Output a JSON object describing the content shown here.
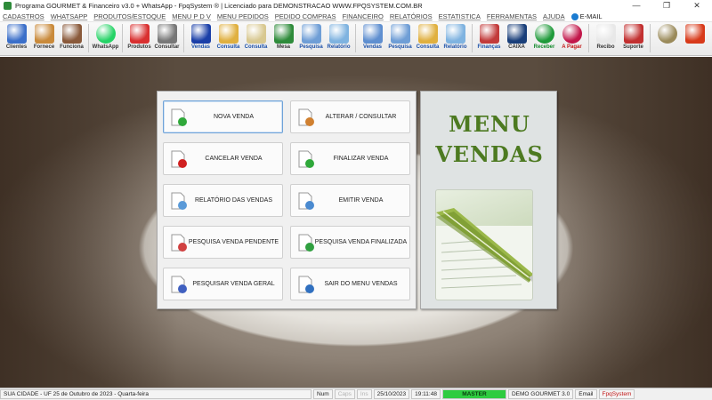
{
  "window": {
    "title": "Programa GOURMET & Financeiro v3.0 + WhatsApp - FpqSystem ® | Licenciado para  DEMONSTRACAO WWW.FPQSYSTEM.COM.BR",
    "minimize": "—",
    "maximize": "❐",
    "close": "✕"
  },
  "menu": [
    "CADASTROS",
    "WHATSAPP",
    "PRODUTOS/ESTOQUE",
    "MENU P D V",
    "MENU PEDIDOS",
    "PEDIDO COMPRAS",
    "FINANCEIRO",
    "RELATÓRIOS",
    "ESTATISTICA",
    "FERRAMENTAS",
    "AJUDA"
  ],
  "menu_email": "E-MAIL",
  "toolbar": [
    {
      "label": "Clientes",
      "icon": "clients-icon",
      "color": "#3b6fc9"
    },
    {
      "label": "Fornece",
      "icon": "suppliers-icon",
      "color": "#c98a3b"
    },
    {
      "label": "Funciona",
      "icon": "employees-icon",
      "color": "#8a5a3b"
    },
    {
      "label": "WhatsApp",
      "icon": "whatsapp-icon",
      "color": "#25d366"
    },
    {
      "label": "Produtos",
      "icon": "products-icon",
      "color": "#d93030"
    },
    {
      "label": "Consultar",
      "icon": "barcode-icon",
      "color": "#777777"
    },
    {
      "label": "Vendas",
      "icon": "pdv-icon",
      "color": "#1a3fa8"
    },
    {
      "label": "Consulta",
      "icon": "folder-icon",
      "color": "#e0b040"
    },
    {
      "label": "Consulta",
      "icon": "receipt-icon",
      "color": "#d8c890"
    },
    {
      "label": "Mesa",
      "icon": "table-umbrella-icon",
      "color": "#2e8b3a"
    },
    {
      "label": "Pesquisa",
      "icon": "search-doc-icon",
      "color": "#6f9ed6"
    },
    {
      "label": "Relatório",
      "icon": "printer-icon",
      "color": "#7fb3e0"
    },
    {
      "label": "Vendas",
      "icon": "monitor-icon",
      "color": "#5f8fd0"
    },
    {
      "label": "Pesquisa",
      "icon": "search-doc-icon",
      "color": "#6f9ed6"
    },
    {
      "label": "Consulta",
      "icon": "folder-icon",
      "color": "#e0b040"
    },
    {
      "label": "Relatório",
      "icon": "printer-icon",
      "color": "#7fb3e0"
    },
    {
      "label": "Finanças",
      "icon": "finance-icon",
      "color": "#c23a3a"
    },
    {
      "label": "CAIXA",
      "icon": "cashbook-icon",
      "color": "#1a3f7a"
    },
    {
      "label": "Receber",
      "icon": "receive-money-icon",
      "color": "#1f9a3a"
    },
    {
      "label": "A Pagar",
      "icon": "pay-money-icon",
      "color": "#c2174a"
    },
    {
      "label": "Recibo",
      "icon": "receipt-note-icon",
      "color": "#e8e8e8"
    },
    {
      "label": "Suporte",
      "icon": "support-icon",
      "color": "#c23030"
    },
    {
      "label": "",
      "icon": "coin-icon",
      "color": "#9a8a5a"
    },
    {
      "label": "",
      "icon": "exit-icon",
      "color": "#d83a1a"
    }
  ],
  "buttons": [
    {
      "label": "NOVA VENDA",
      "icon": "new-doc-icon"
    },
    {
      "label": "ALTERAR / CONSULTAR",
      "icon": "edit-doc-icon"
    },
    {
      "label": "CANCELAR VENDA",
      "icon": "cancel-doc-icon"
    },
    {
      "label": "FINALIZAR VENDA",
      "icon": "check-doc-icon"
    },
    {
      "label": "RELATÓRIO DAS VENDAS",
      "icon": "printer-icon"
    },
    {
      "label": "EMITIR VENDA",
      "icon": "emit-icon"
    },
    {
      "label": "PESQUISA VENDA PENDENTE",
      "icon": "search-pending-icon"
    },
    {
      "label": "PESQUISA VENDA FINALIZADA",
      "icon": "search-finished-icon"
    },
    {
      "label": "PESQUISAR VENDA GERAL",
      "icon": "search-general-icon"
    },
    {
      "label": "SAIR DO MENU VENDAS",
      "icon": "exit-menu-icon"
    }
  ],
  "side": {
    "line1": "MENU",
    "line2": "VENDAS"
  },
  "status": {
    "city": "SUA CIDADE - UF 25 de Outubro de 2023 - Quarta-feira",
    "num": "Num",
    "caps": "Caps",
    "ins": "Ins",
    "date": "25/10/2023",
    "time": "19:11:48",
    "user": "MASTER",
    "company": "DEMO GOURMET 3.0",
    "email": "Email",
    "brand": "FpqSystem"
  }
}
